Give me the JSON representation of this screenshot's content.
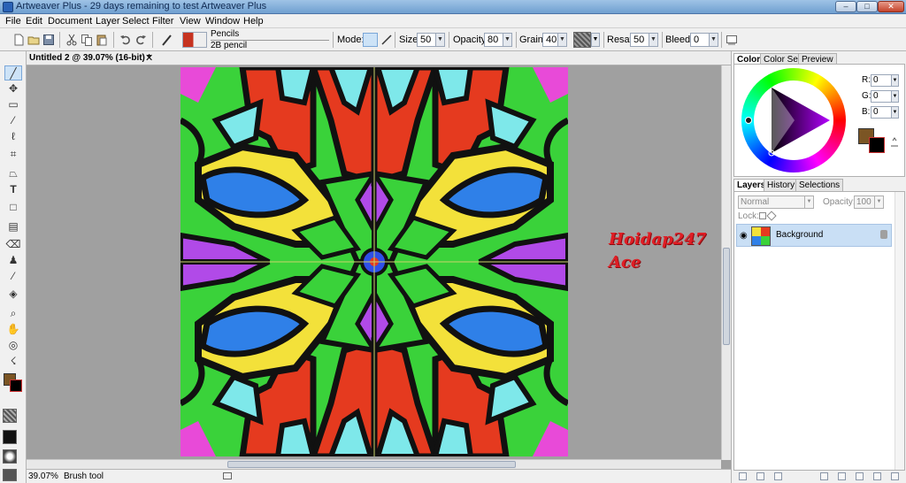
{
  "window": {
    "title": "Artweaver Plus - 29 days remaining to test Artweaver Plus",
    "minimize": "–",
    "maximize": "□",
    "close": "✕"
  },
  "menu": [
    "File",
    "Edit",
    "Document",
    "Layer",
    "Select",
    "Filter",
    "View",
    "Window",
    "Help"
  ],
  "options": {
    "brush_category": "Pencils",
    "brush_variant": "2B pencil",
    "mode_label": "Mode:",
    "size_label": "Size:",
    "size_value": "50",
    "opacity_label": "Opacity:",
    "opacity_value": "80",
    "grain_label": "Grain:",
    "grain_value": "40",
    "resat_label": "Resat:",
    "resat_value": "50",
    "bleed_label": "Bleed:",
    "bleed_value": "0"
  },
  "document": {
    "tab_title": "Untitled 2 @ 39.07% (16-bit) *",
    "tab_close": "✕"
  },
  "signature": {
    "line1": "Hoidap247",
    "line2": "Ace"
  },
  "status": {
    "zoom": "39.07%",
    "tool": "Brush tool"
  },
  "color_panel": {
    "tabs": [
      "Color",
      "Color Set",
      "Preview"
    ],
    "r_label": "R:",
    "r_value": "0",
    "g_label": "G:",
    "g_value": "0",
    "b_label": "B:",
    "b_value": "0",
    "primary_color": "#7b5524",
    "secondary_color": "#000000"
  },
  "layers_panel": {
    "tabs": [
      "Layers",
      "History",
      "Selections"
    ],
    "blend_mode": "Normal",
    "opacity_label": "Opacity:",
    "opacity_value": "100",
    "lock_label": "Lock:",
    "layer_name": "Background"
  },
  "tools": [
    "brush-icon",
    "move-icon",
    "rect-select-icon",
    "magic-wand-icon",
    "lasso-icon",
    "crop-icon",
    "perspective-icon",
    "text-icon",
    "shape-icon",
    "eraser-icon",
    "stamp-icon",
    "eyedropper-icon",
    "bucket-icon",
    "zoom-icon",
    "hand-icon",
    "rotate-icon",
    "gradient-icon"
  ]
}
